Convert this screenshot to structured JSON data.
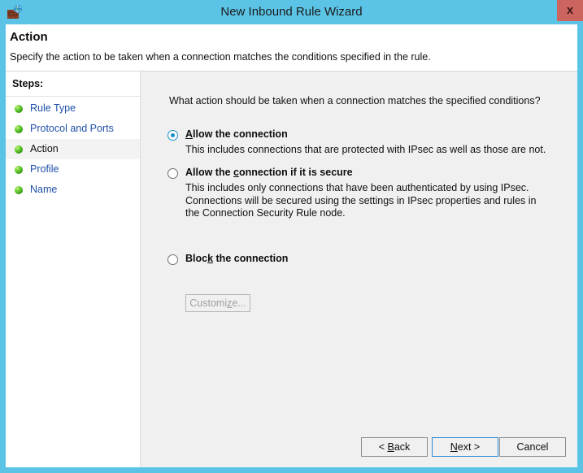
{
  "window": {
    "title": "New Inbound Rule Wizard",
    "icon": "firewall-brick-globe-icon",
    "close_label": "x",
    "accent_titlebar": "#5bc4e6",
    "accent_close": "#cc6460"
  },
  "header": {
    "title": "Action",
    "subtitle": "Specify the action to be taken when a connection matches the conditions specified in the rule."
  },
  "sidebar": {
    "heading": "Steps:",
    "items": [
      {
        "label": "Rule Type",
        "current": false
      },
      {
        "label": "Protocol and Ports",
        "current": false
      },
      {
        "label": "Action",
        "current": true
      },
      {
        "label": "Profile",
        "current": false
      },
      {
        "label": "Name",
        "current": false
      }
    ]
  },
  "main": {
    "question": "What action should be taken when a connection matches the specified conditions?",
    "options": [
      {
        "label_pre": "",
        "label_accel": "A",
        "label_post": "llow the connection",
        "label_full": "Allow the connection",
        "description": "This includes connections that are protected with IPsec as well as those are not.",
        "selected": true
      },
      {
        "label_pre": "Allow the ",
        "label_accel": "c",
        "label_post": "onnection if it is secure",
        "label_full": "Allow the connection if it is secure",
        "description": "This includes only connections that have been authenticated by using IPsec.  Connections will be secured using the settings in IPsec properties and rules in the Connection Security Rule node.",
        "selected": false
      },
      {
        "label_pre": "Bloc",
        "label_accel": "k",
        "label_post": " the connection",
        "label_full": "Block the connection",
        "description": "",
        "selected": false
      }
    ],
    "customize_button": {
      "label_pre": "Customi",
      "label_accel": "z",
      "label_post": "e...",
      "label_full": "Customize...",
      "enabled": false
    }
  },
  "footer": {
    "back": {
      "label_pre": "< ",
      "label_accel": "B",
      "label_post": "ack",
      "label_full": "< Back"
    },
    "next": {
      "label_pre": "",
      "label_accel": "N",
      "label_post": "ext >",
      "label_full": "Next >",
      "default": true
    },
    "cancel": {
      "label_full": "Cancel"
    }
  }
}
